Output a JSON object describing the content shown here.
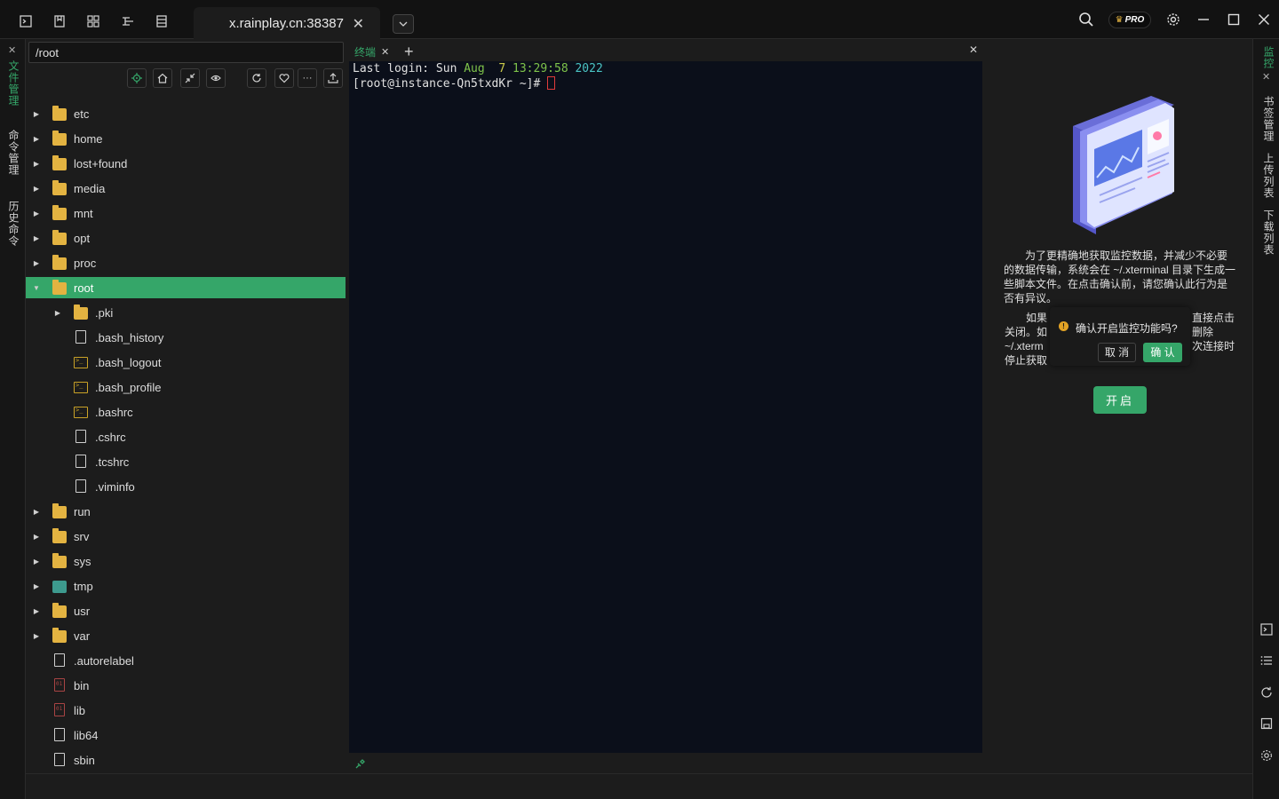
{
  "window": {
    "tab_title": "x.rainplay.cn:38387",
    "pro_badge": "PRO"
  },
  "left_tabs": {
    "file_manager": "文件管理",
    "command_manager": "命令管理",
    "history_commands": "历史命令"
  },
  "file_panel": {
    "path": "/root",
    "tree": [
      {
        "name": "etc",
        "type": "folder",
        "depth": 0,
        "expanded": false
      },
      {
        "name": "home",
        "type": "folder",
        "depth": 0,
        "expanded": false
      },
      {
        "name": "lost+found",
        "type": "folder",
        "depth": 0,
        "expanded": false
      },
      {
        "name": "media",
        "type": "folder",
        "depth": 0,
        "expanded": false
      },
      {
        "name": "mnt",
        "type": "folder",
        "depth": 0,
        "expanded": false
      },
      {
        "name": "opt",
        "type": "folder",
        "depth": 0,
        "expanded": false
      },
      {
        "name": "proc",
        "type": "folder",
        "depth": 0,
        "expanded": false
      },
      {
        "name": "root",
        "type": "folder",
        "depth": 0,
        "expanded": true,
        "selected": true
      },
      {
        "name": ".pki",
        "type": "folder",
        "depth": 1,
        "expanded": false
      },
      {
        "name": ".bash_history",
        "type": "file",
        "depth": 1
      },
      {
        "name": ".bash_logout",
        "type": "script",
        "depth": 1
      },
      {
        "name": ".bash_profile",
        "type": "script",
        "depth": 1
      },
      {
        "name": ".bashrc",
        "type": "script",
        "depth": 1
      },
      {
        "name": ".cshrc",
        "type": "file",
        "depth": 1
      },
      {
        "name": ".tcshrc",
        "type": "file",
        "depth": 1
      },
      {
        "name": ".viminfo",
        "type": "file",
        "depth": 1
      },
      {
        "name": "run",
        "type": "folder",
        "depth": 0,
        "expanded": false
      },
      {
        "name": "srv",
        "type": "folder",
        "depth": 0,
        "expanded": false
      },
      {
        "name": "sys",
        "type": "folder",
        "depth": 0,
        "expanded": false
      },
      {
        "name": "tmp",
        "type": "tmp",
        "depth": 0,
        "expanded": false
      },
      {
        "name": "usr",
        "type": "folder",
        "depth": 0,
        "expanded": false
      },
      {
        "name": "var",
        "type": "folder",
        "depth": 0,
        "expanded": false
      },
      {
        "name": ".autorelabel",
        "type": "file",
        "depth": 0
      },
      {
        "name": "bin",
        "type": "binary",
        "depth": 0
      },
      {
        "name": "lib",
        "type": "binary",
        "depth": 0
      },
      {
        "name": "lib64",
        "type": "file",
        "depth": 0
      },
      {
        "name": "sbin",
        "type": "file",
        "depth": 0
      }
    ]
  },
  "terminal": {
    "tab_label": "终端",
    "line1_prefix": "Last login: Sun ",
    "line1_month": "Aug",
    "line1_day": "  7",
    "line1_time": " 13:29:58",
    "line1_year": " 2022",
    "prompt": "[root@instance-Qn5txdKr ~]# "
  },
  "monitor": {
    "description": "为了更精确地获取监控数据，并减少不必要的数据传输，系统会在 ~/.xterminal 目录下生成一些脚本文件。在点击确认前，请您确认此行为是否有异议。",
    "partial_left": [
      "如果",
      "关闭。如",
      "~/.xterm",
      "停止获取"
    ],
    "partial_right": [
      "直接点击",
      "删除",
      "次连接时"
    ],
    "popover_question": "确认开启监控功能吗?",
    "cancel_label": "取 消",
    "confirm_label": "确 认",
    "enable_label": "开启"
  },
  "right_tabs": {
    "monitor": "监控",
    "bookmarks": "书签管理",
    "upload_list": "上传列表",
    "download_list": "下载列表"
  },
  "colors": {
    "accent": "#35a669",
    "terminal_bg": "#0b0f1a",
    "folder": "#e3b341"
  }
}
